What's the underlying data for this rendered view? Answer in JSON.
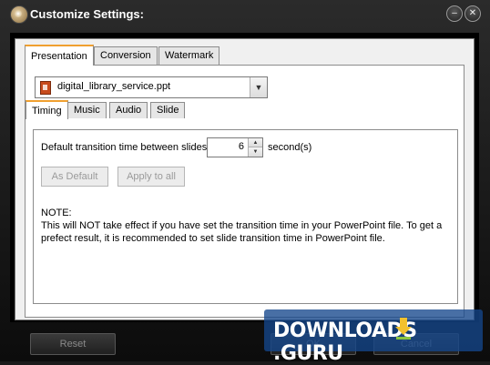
{
  "window": {
    "title": "Customize Settings:"
  },
  "main_tabs": [
    {
      "label": "Presentation",
      "active": true
    },
    {
      "label": "Conversion",
      "active": false
    },
    {
      "label": "Watermark",
      "active": false
    }
  ],
  "file_select": {
    "value": "digital_library_service.ppt"
  },
  "sub_tabs": [
    {
      "label": "Timing",
      "active": true
    },
    {
      "label": "Music",
      "active": false
    },
    {
      "label": "Audio",
      "active": false
    },
    {
      "label": "Slide",
      "active": false
    }
  ],
  "timing": {
    "transition_label": "Default transition time between slides:",
    "transition_value": "6",
    "unit": "second(s)",
    "as_default_label": "As Default",
    "apply_all_label": "Apply to all",
    "note_title": "NOTE:",
    "note_text": "This will NOT take effect if you have set the transition time in your PowerPoint file. To get a prefect result, it is recommended to set slide transition time in PowerPoint file."
  },
  "footer": {
    "reset_label": "Reset",
    "ok_label": "OK",
    "cancel_label": "Cancel"
  },
  "watermark": {
    "text": "DOWNLOADS",
    "suffix": ".GURU",
    "color": "#1c4f92"
  }
}
